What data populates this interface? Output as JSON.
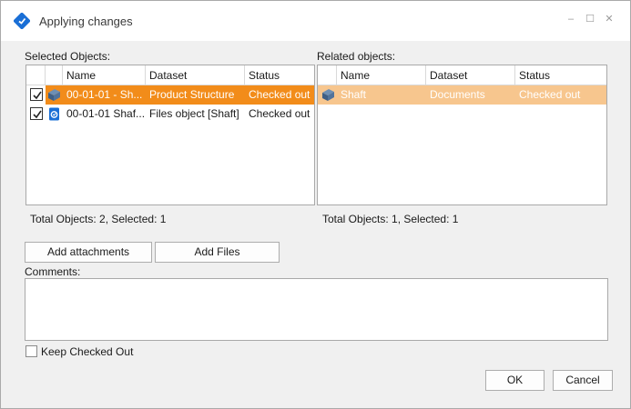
{
  "window": {
    "title": "Applying changes",
    "controls": {
      "minimize": "–",
      "maximize": "☐",
      "close": "✕"
    }
  },
  "selected_objects": {
    "label": "Selected Objects:",
    "columns": [
      "Name",
      "Dataset",
      "Status"
    ],
    "rows": [
      {
        "checked": true,
        "icon": "product-structure-icon",
        "name": "00-01-01 - Sh...",
        "dataset": "Product Structure",
        "status": "Checked out",
        "selected": true
      },
      {
        "checked": true,
        "icon": "files-object-icon",
        "name": "00-01-01 Shaf...",
        "dataset": "Files object [Shaft]",
        "status": "Checked out",
        "selected": false
      }
    ],
    "summary": "Total Objects: 2, Selected: 1"
  },
  "related_objects": {
    "label": "Related objects:",
    "columns": [
      "Name",
      "Dataset",
      "Status"
    ],
    "rows": [
      {
        "icon": "shaft-icon",
        "name": "Shaft",
        "dataset": "Documents",
        "status": "Checked out",
        "selected": true
      }
    ],
    "summary": "Total Objects: 1, Selected: 1"
  },
  "buttons": {
    "add_attachments": "Add attachments",
    "add_files": "Add Files",
    "ok": "OK",
    "cancel": "Cancel"
  },
  "comments": {
    "label": "Comments:",
    "value": ""
  },
  "keep_checked_out": {
    "label": "Keep Checked Out",
    "checked": false
  },
  "colors": {
    "selected_row_active": "#f28c1a",
    "selected_row_inactive": "#f7c68e",
    "app_icon": "#1a6fd6"
  }
}
